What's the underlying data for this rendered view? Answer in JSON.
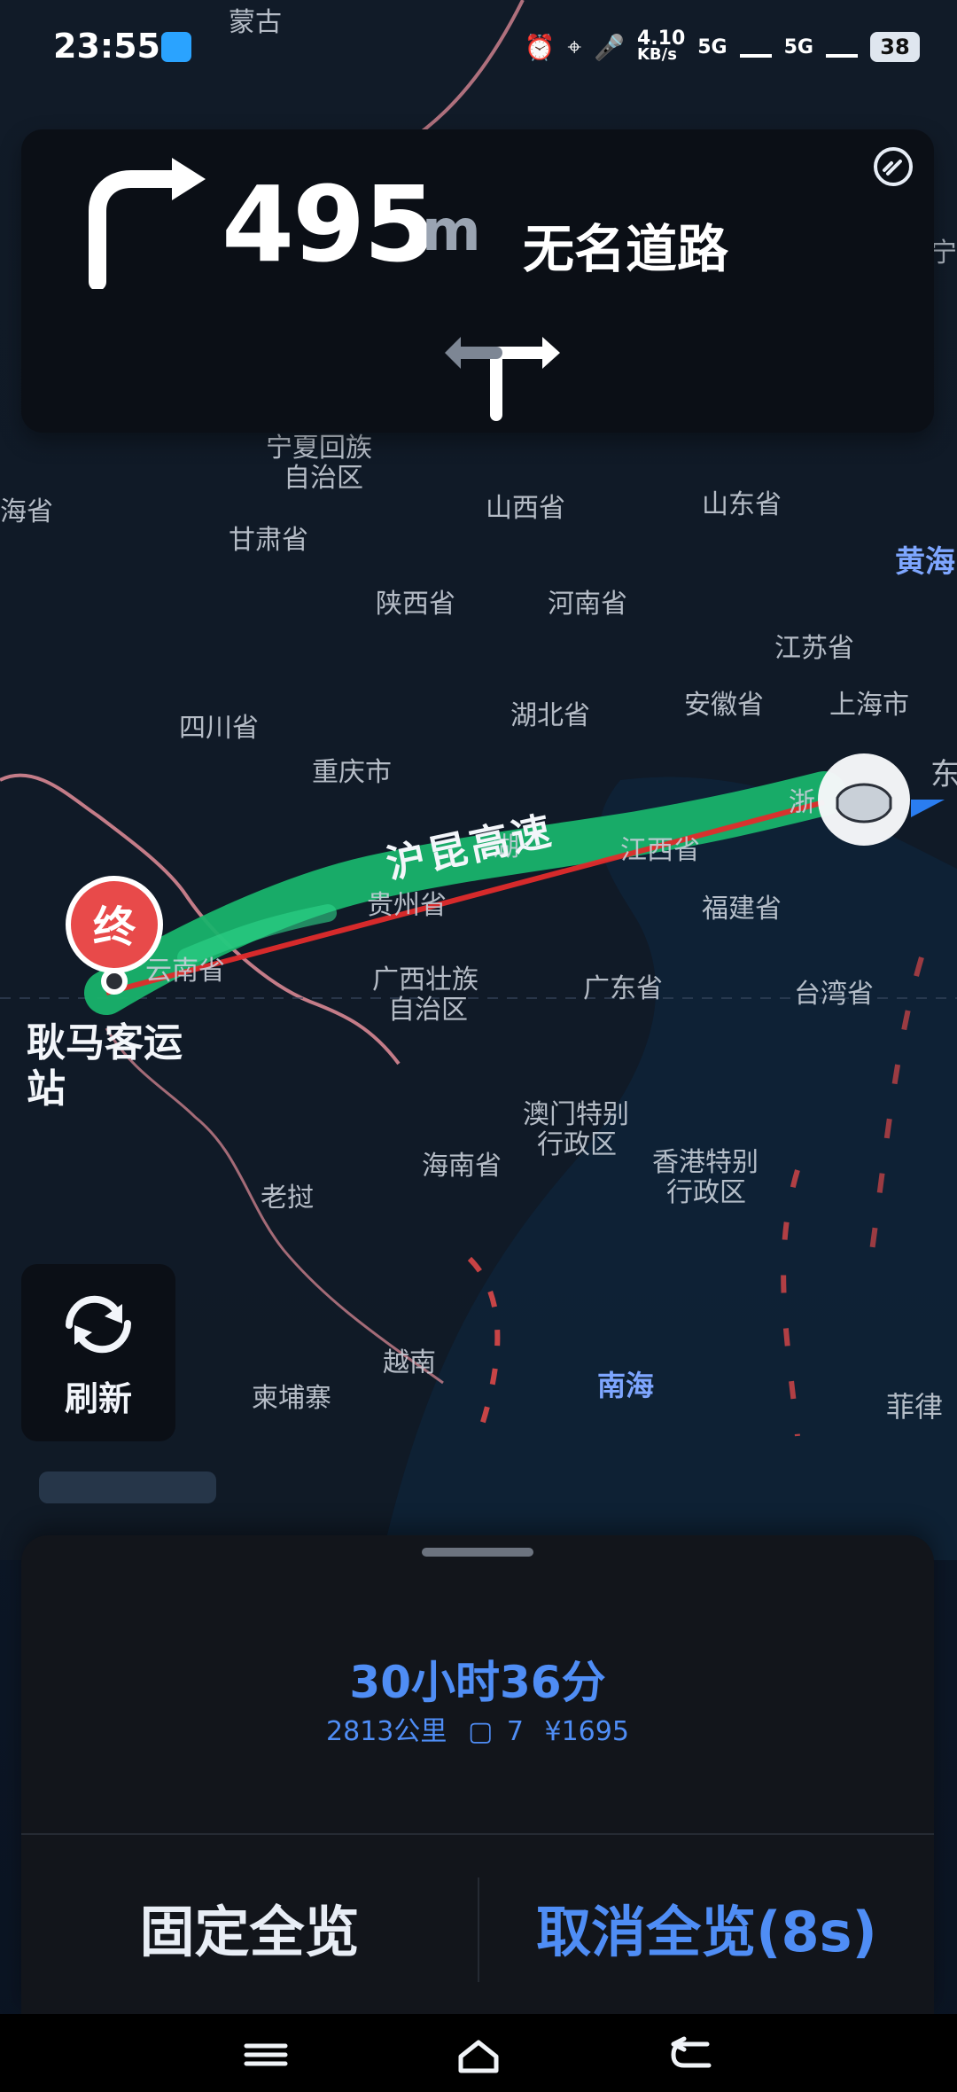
{
  "status_bar": {
    "time": "23:55",
    "net_speed_value": "4.10",
    "net_speed_unit": "KB/s",
    "network_1": "5G",
    "network_2": "5G",
    "battery": "38"
  },
  "nav_card": {
    "distance_value": "495",
    "distance_unit": "m",
    "road_name": "无名道路"
  },
  "map_labels": {
    "top_clip": "蒙古",
    "hai_sheng": "海省",
    "ningxia_1": "宁夏回族",
    "ningxia_2": "自治区",
    "gansu": "甘肃省",
    "shanxi": "山西省",
    "shandong": "山东省",
    "huanghai": "黄海",
    "shaanxi": "陕西省",
    "henan": "河南省",
    "jiangsu": "江苏省",
    "hubei": "湖北省",
    "anhui": "安徽省",
    "shanghai": "上海市",
    "sichuan": "四川省",
    "chongqing": "重庆市",
    "hunan_part": "湖",
    "zhejiang_part": "浙",
    "dong_part": "东",
    "highway_name": "沪昆高速",
    "jiangxi": "江西省",
    "guizhou": "贵州省",
    "yunnan": "云南省",
    "fujian": "福建省",
    "guangxi_1": "广西壮族",
    "guangxi_2": "自治区",
    "guangdong": "广东省",
    "taiwan": "台湾省",
    "destination_1": "耿马客运",
    "destination_2": "站",
    "macau_1": "澳门特别",
    "macau_2": "行政区",
    "hongkong_1": "香港特别",
    "hongkong_2": "行政区",
    "hainan": "海南省",
    "laos": "老挝",
    "vietnam": "越南",
    "cambodia": "柬埔寨",
    "south_sea": "南海",
    "philippines_part": "菲律",
    "ning_part": "宁"
  },
  "markers": {
    "end_label": "终"
  },
  "refresh_button": {
    "label": "刷新"
  },
  "route_summary": {
    "eta": "30小时36分",
    "distance": "2813公里",
    "lights": "7",
    "toll": "¥1695"
  },
  "actions": {
    "fix_overview": "固定全览",
    "cancel_overview": "取消全览(8s)"
  },
  "colors": {
    "accent_blue": "#4f8df5",
    "route_green": "#19b36b",
    "route_red": "#e12b2b",
    "end_marker": "#e84a4a"
  }
}
